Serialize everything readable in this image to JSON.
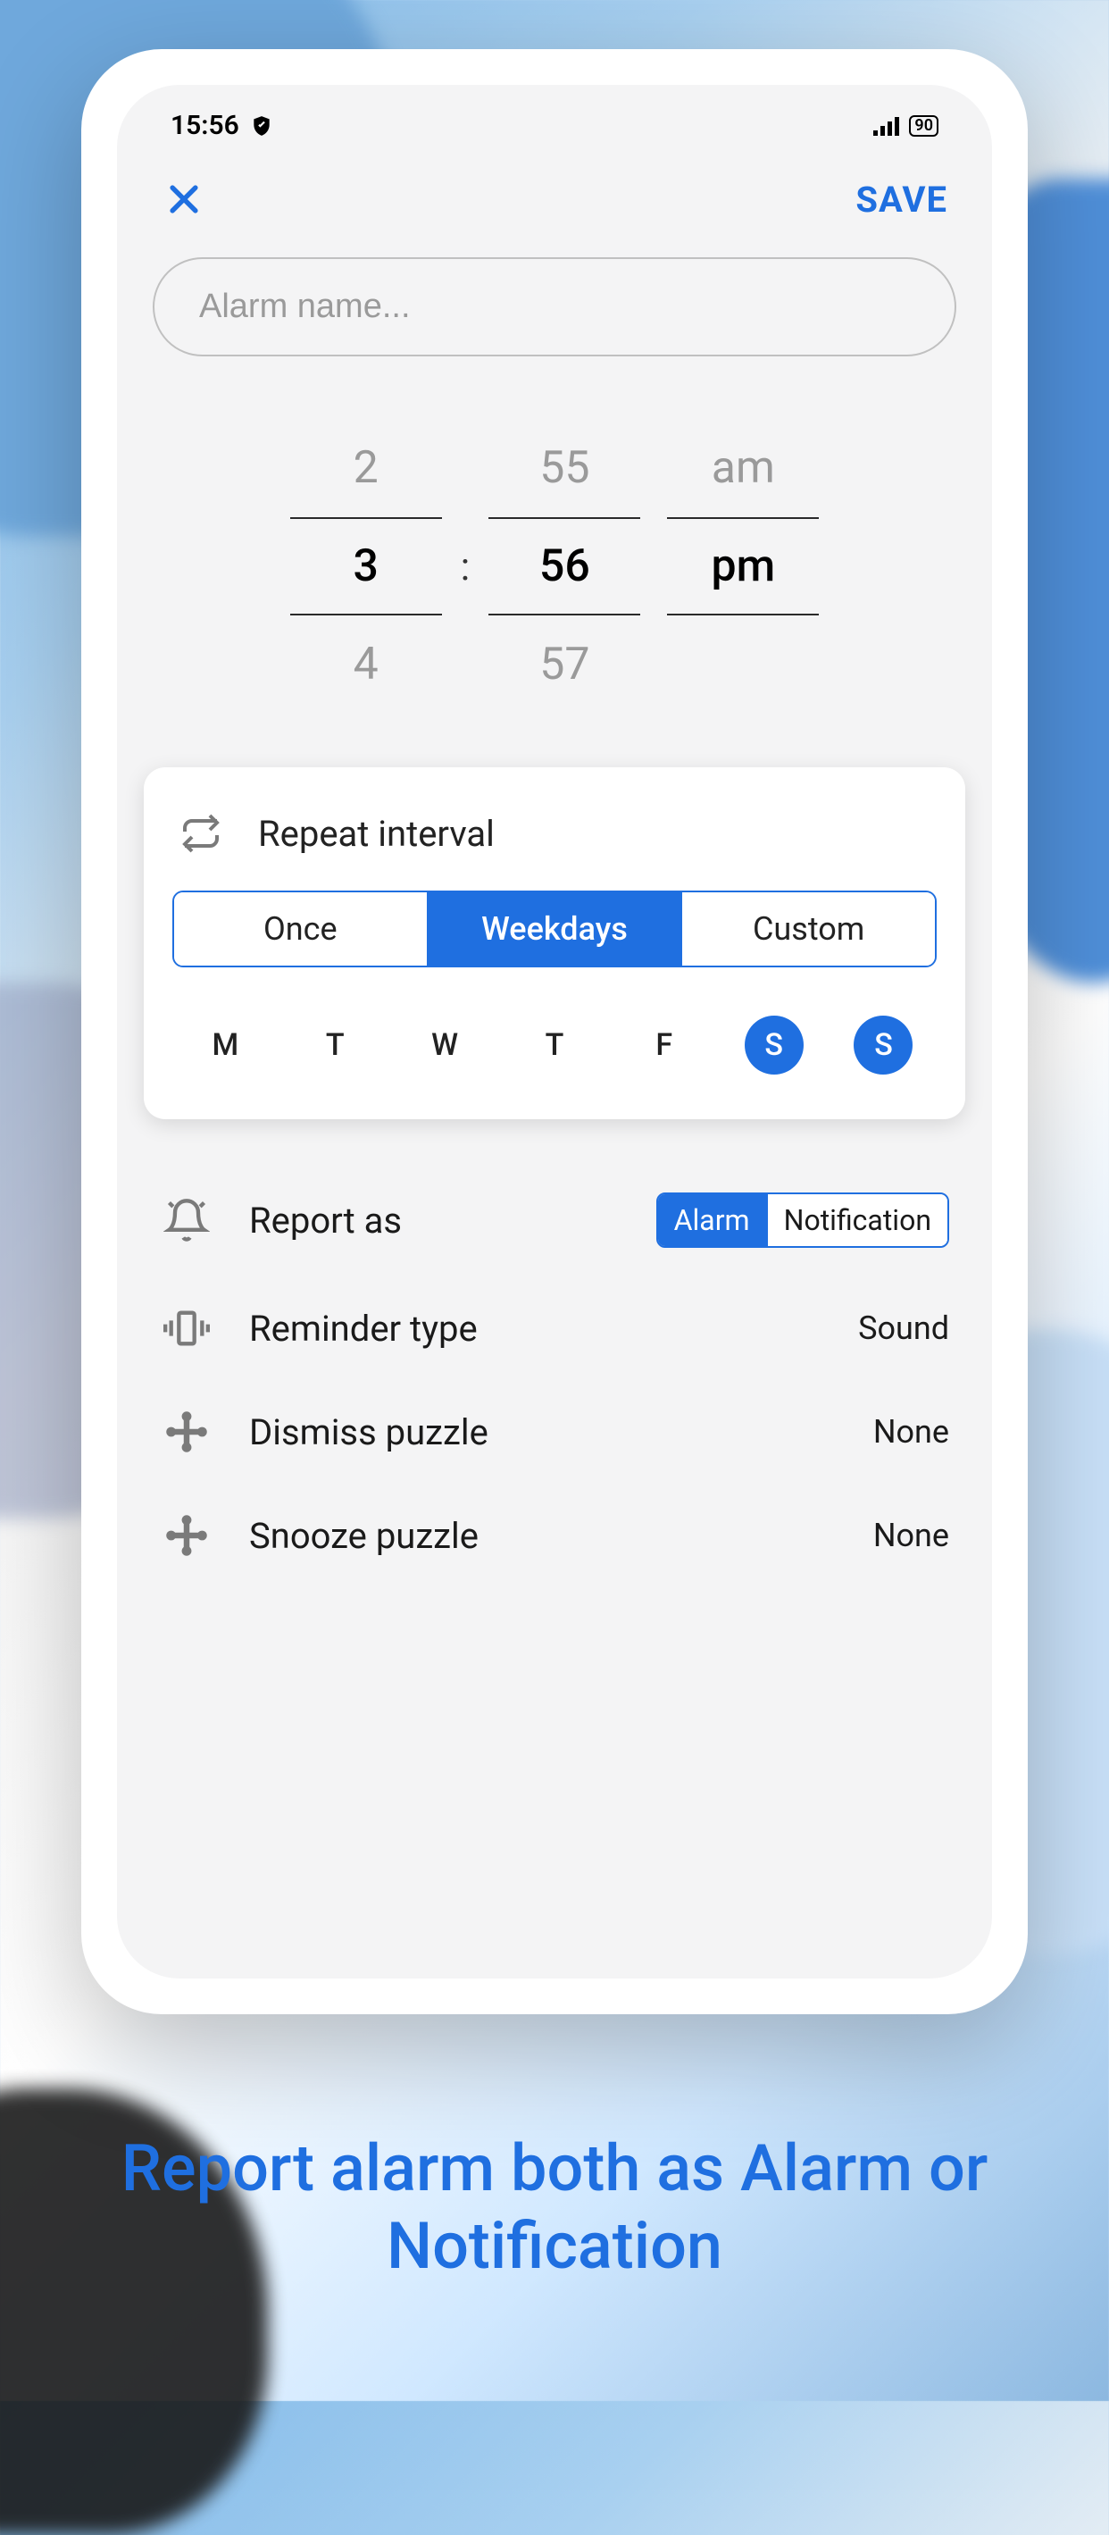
{
  "status_bar": {
    "time": "15:56",
    "battery": "90"
  },
  "header": {
    "save_label": "SAVE"
  },
  "alarm_name": {
    "placeholder": "Alarm name...",
    "value": ""
  },
  "time_picker": {
    "hour_prev": "2",
    "hour_selected": "3",
    "hour_next": "4",
    "minute_prev": "55",
    "minute_selected": "56",
    "minute_next": "57",
    "period_prev": "am",
    "period_selected": "pm",
    "separator": ":"
  },
  "repeat": {
    "title": "Repeat interval",
    "options": [
      "Once",
      "Weekdays",
      "Custom"
    ],
    "selected": "Weekdays",
    "days": [
      {
        "label": "M",
        "active": false
      },
      {
        "label": "T",
        "active": false
      },
      {
        "label": "W",
        "active": false
      },
      {
        "label": "T",
        "active": false
      },
      {
        "label": "F",
        "active": false
      },
      {
        "label": "S",
        "active": true
      },
      {
        "label": "S",
        "active": true
      }
    ]
  },
  "settings": {
    "report_as": {
      "label": "Report as",
      "options": [
        "Alarm",
        "Notification"
      ],
      "selected": "Alarm"
    },
    "reminder_type": {
      "label": "Reminder type",
      "value": "Sound"
    },
    "dismiss_puzzle": {
      "label": "Dismiss puzzle",
      "value": "None"
    },
    "snooze_puzzle": {
      "label": "Snooze puzzle",
      "value": "None"
    }
  },
  "caption": "Report alarm both as Alarm or Notification"
}
